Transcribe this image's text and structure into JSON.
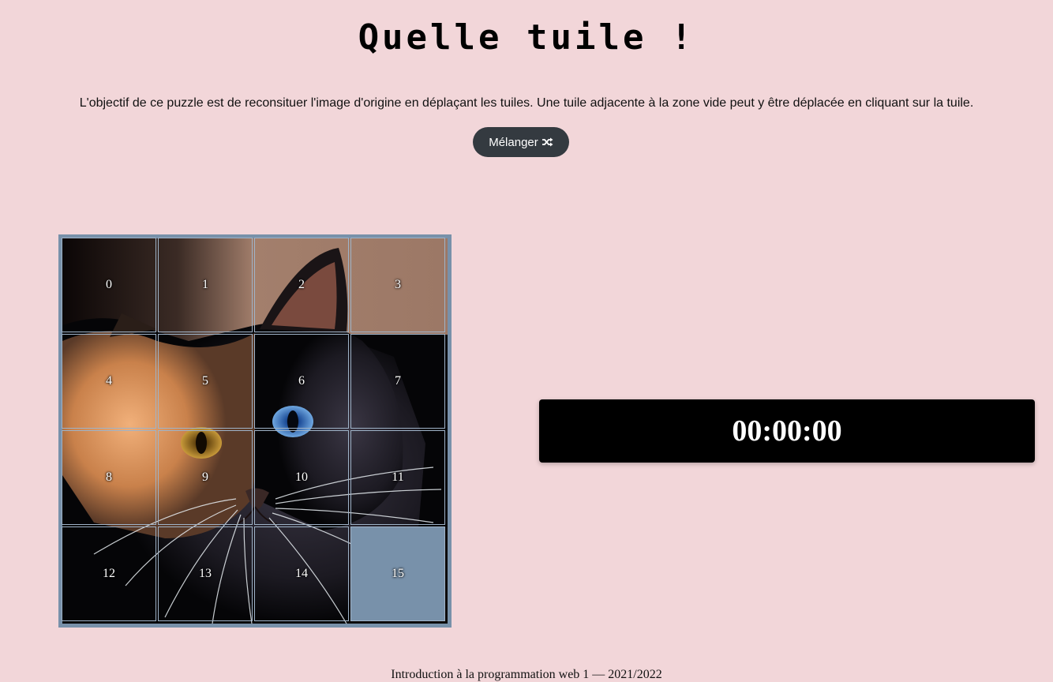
{
  "header": {
    "title": "Quelle tuile !",
    "intro": "L'objectif de ce puzzle est de reconsituer l'image d'origine en déplaçant les tuiles. Une tuile adjacente à la zone vide peut y être déplacée en cliquant sur la tuile."
  },
  "controls": {
    "shuffle_label": "Mélanger",
    "shuffle_icon": "shuffle-icon"
  },
  "puzzle": {
    "empty_tile": "15",
    "tiles": [
      "0",
      "1",
      "2",
      "3",
      "4",
      "5",
      "6",
      "7",
      "8",
      "9",
      "10",
      "11",
      "12",
      "13",
      "14",
      "15"
    ]
  },
  "timer": {
    "value": "00:00:00"
  },
  "footer": {
    "text": "Introduction à la programmation web 1 — 2021/2022"
  },
  "colors": {
    "background": "#f2d6d9",
    "button": "#343a40",
    "board": "#7891aa",
    "timer_bg": "#000000"
  }
}
